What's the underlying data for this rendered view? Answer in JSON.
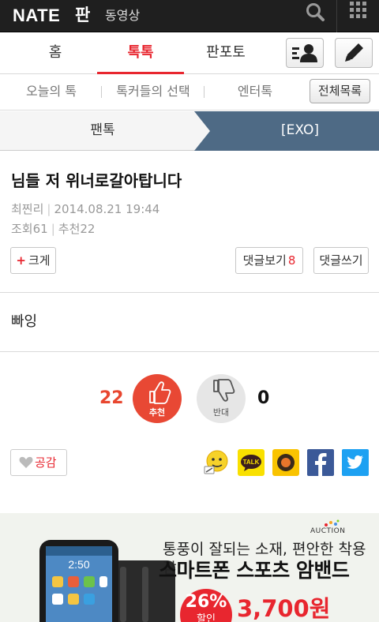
{
  "topbar": {
    "logo_brand": "NATE",
    "logo_service": "판",
    "video_link": "동영상",
    "icons": [
      "search-icon",
      "grid-menu-icon"
    ]
  },
  "nav": {
    "tabs": [
      {
        "label": "홈",
        "active": false
      },
      {
        "label": "톡톡",
        "active": true
      },
      {
        "label": "판포토",
        "active": false
      }
    ],
    "buttons": [
      "profile-list-icon",
      "pencil-icon"
    ]
  },
  "subnav": {
    "items": [
      "오늘의 톡",
      "톡커들의 선택",
      "엔터톡"
    ],
    "all_button": "전체목록"
  },
  "breadcrumb": {
    "parent": "팬톡",
    "current": "[EXO]"
  },
  "article": {
    "title": "님들 저 위너로갈아탑니다",
    "author": "최찐리",
    "date": "2014.08.21 19:44",
    "views_label": "조회",
    "views": "61",
    "recommend_label": "추천",
    "recommend": "22",
    "font_button": "크게",
    "comments_view_label": "댓글보기",
    "comments_count": "8",
    "comment_write_label": "댓글쓰기",
    "body": "빠잉"
  },
  "vote": {
    "up_count": "22",
    "up_label": "추천",
    "down_count": "0",
    "down_label": "반대"
  },
  "share": {
    "like_label": "공감",
    "kakao_talk_text": "TALK",
    "targets": [
      "nate-emoticon-icon",
      "kakaotalk-icon",
      "kakaostory-icon",
      "facebook-icon",
      "twitter-icon"
    ]
  },
  "ad": {
    "brand": "AUCTION",
    "headline": "통풍이 잘되는 소재, 편안한 착용감!",
    "product": "스마트폰 스포츠 암밴드",
    "discount": "26%",
    "discount_sub": "할인",
    "price": "3,700원",
    "phone_time": "2:50"
  },
  "colors": {
    "accent": "#e8262f",
    "topbar": "#1f1f1f",
    "breadcrumb_active": "#4e6a85",
    "facebook": "#3b5998",
    "twitter": "#1da1f2",
    "kakao": "#f9e000"
  }
}
